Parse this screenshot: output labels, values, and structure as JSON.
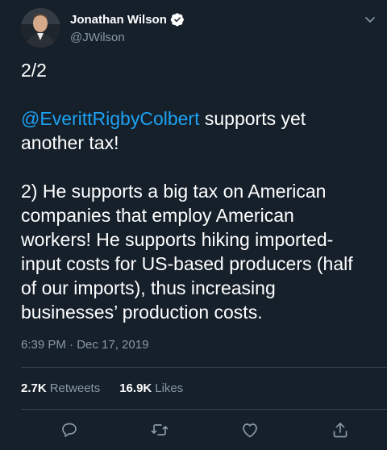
{
  "tweet": {
    "author_name": "Jonathan Wilson",
    "handle": "@JWilson",
    "lines": {
      "l1": "2/2",
      "l2_mention": "@EverittRigbyColbert",
      "l2_rest": " supports yet",
      "l3": "another tax!",
      "l4": "2) He supports a big tax on American",
      "l5": "companies that employ American",
      "l6": "workers! He supports hiking imported-",
      "l7": "input costs for US-based producers (half",
      "l8": "of our imports), thus increasing",
      "l9": "businesses’ production costs."
    },
    "timestamp": "6:39 PM · Dec 17, 2019",
    "retweets_count": "2.7K",
    "retweets_label": "Retweets",
    "likes_count": "16.9K",
    "likes_label": "Likes"
  },
  "icons": {
    "verified": "verified-badge-icon",
    "more": "chevron-down-icon",
    "reply": "reply-icon",
    "retweet": "retweet-icon",
    "like": "heart-icon",
    "share": "share-icon"
  },
  "colors": {
    "background": "#15202b",
    "accent": "#1da1f2",
    "secondary_text": "#8899a6",
    "divider": "#38444d"
  }
}
